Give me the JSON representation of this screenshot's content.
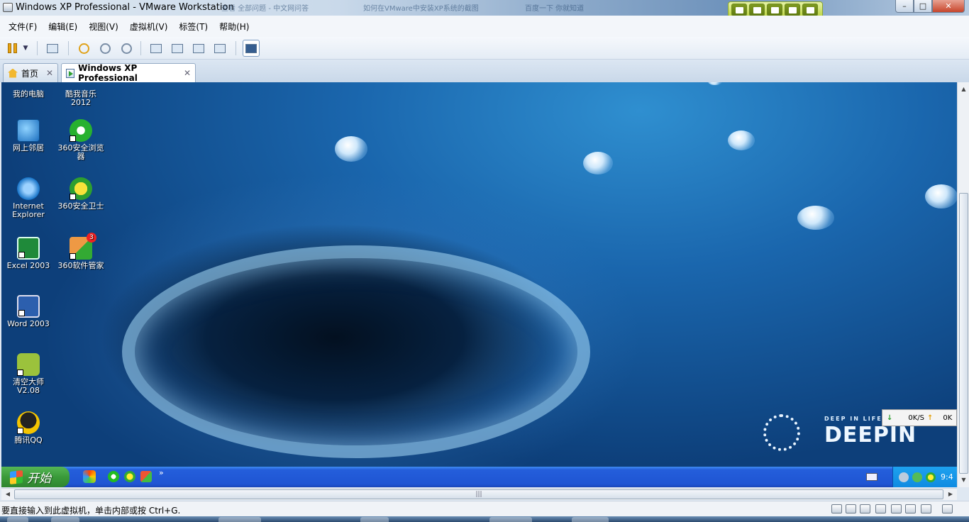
{
  "window": {
    "title": "Windows XP Professional - VMware Workstation",
    "background_tabs": [
      "查看 全部问题 - 中文网问答",
      "如何在VMware中安装XP系统的截图",
      "百度一下 你就知道"
    ],
    "controls": {
      "minimize": "–",
      "maximize": "□",
      "close": "✕"
    }
  },
  "menu": {
    "items": [
      "文件(F)",
      "编辑(E)",
      "视图(V)",
      "虚拟机(V)",
      "标签(T)",
      "帮助(H)"
    ]
  },
  "tabs": [
    {
      "label": "首页",
      "close": "✕"
    },
    {
      "label": "Windows XP Professional",
      "close": "✕"
    }
  ],
  "desktop": {
    "icons_left": [
      {
        "label": "我的电脑",
        "icon": "computer-icon"
      },
      {
        "label": "网上邻居",
        "icon": "network-icon"
      },
      {
        "label": "Internet Explorer",
        "icon": "ie-icon"
      },
      {
        "label": "Excel 2003",
        "icon": "excel-icon"
      },
      {
        "label": "Word 2003",
        "icon": "word-icon"
      },
      {
        "label": "清空大师 V2.08",
        "icon": "cleaner-icon"
      },
      {
        "label": "腾讯QQ",
        "icon": "qq-icon"
      }
    ],
    "icons_right": [
      {
        "label": "酷我音乐 2012",
        "icon": "kuwo-icon"
      },
      {
        "label": "360安全浏览器",
        "icon": "360-browser-icon"
      },
      {
        "label": "360安全卫士",
        "icon": "360-safe-icon"
      },
      {
        "label": "360软件管家",
        "icon": "360-soft-icon",
        "badge": "3"
      }
    ],
    "wallpaper": {
      "tagline": "DEEP IN LIFE",
      "brand": "DEEPIN"
    },
    "netspeed": {
      "down": "0K/S",
      "up": "0K"
    }
  },
  "guest_taskbar": {
    "start_label": "开始",
    "more": "»",
    "clock": "9:4"
  },
  "hscroll": {
    "grip": "|||"
  },
  "status": {
    "text": "要直接输入到此虚拟机，单击内部或按 Ctrl+G."
  },
  "colors": {
    "xp_taskbar": "#245edb",
    "start_green": "#3a9a3a",
    "vm_toolbar": "#b8d23c",
    "close_red": "#c7452b"
  }
}
